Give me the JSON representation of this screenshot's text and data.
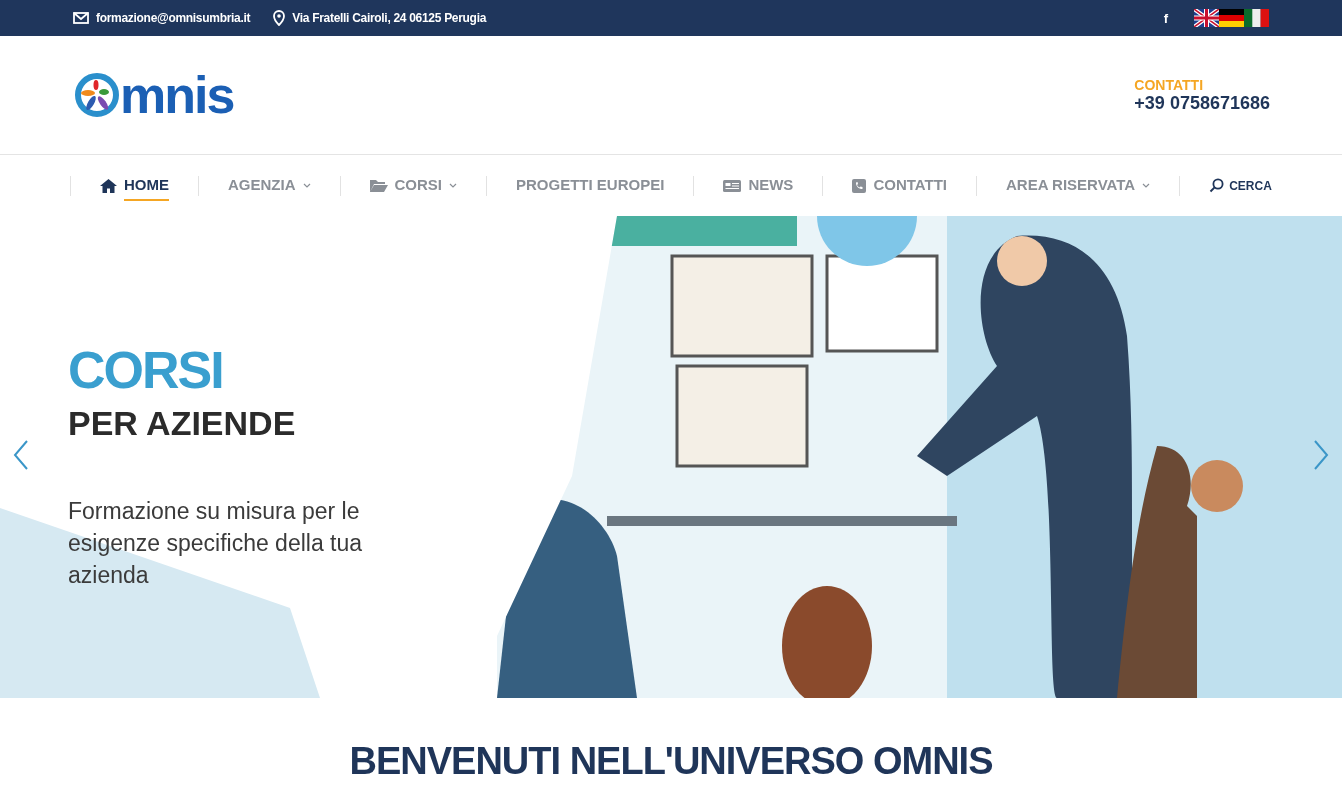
{
  "topbar": {
    "email": "formazione@omnisumbria.it",
    "address": "Via Fratelli Cairoli, 24 06125 Perugia",
    "facebook": "f",
    "flags": [
      {
        "kind": "uk"
      },
      {
        "kind": "de"
      },
      {
        "kind": "it"
      }
    ]
  },
  "header": {
    "logo_text": "mnis",
    "contact_label": "CONTATTI",
    "phone": "+39 0758671686"
  },
  "nav": [
    {
      "label": "HOME",
      "kind": "home",
      "dropdown": false,
      "selected": true
    },
    {
      "label": "AGENZIA",
      "kind": "plain",
      "dropdown": true,
      "selected": false
    },
    {
      "label": "CORSI",
      "kind": "folder",
      "dropdown": true,
      "selected": false
    },
    {
      "label": "PROGETTI EUROPEI",
      "kind": "plain",
      "dropdown": false,
      "selected": false
    },
    {
      "label": "NEWS",
      "kind": "news",
      "dropdown": false,
      "selected": false
    },
    {
      "label": "CONTATTI",
      "kind": "phone",
      "dropdown": false,
      "selected": false
    },
    {
      "label": "AREA RISERVATA",
      "kind": "plain",
      "dropdown": true,
      "selected": false
    }
  ],
  "search_label": "CERCA",
  "hero": {
    "title": "CORSI",
    "subtitle": "PER AZIENDE",
    "text": "Formazione su misura per le esigenze specifiche della tua azienda"
  },
  "welcome_title": "BENVENUTI NELL'UNIVERSO OMNIS"
}
